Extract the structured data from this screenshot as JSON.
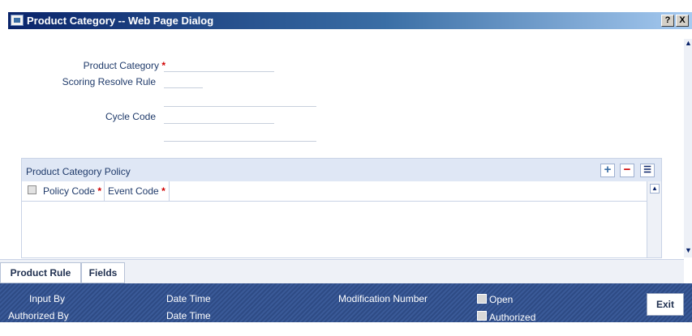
{
  "window": {
    "title": "Product Category -- Web Page Dialog",
    "help_label": "?",
    "close_label": "X"
  },
  "form": {
    "product_category_label": "Product Category",
    "scoring_resolve_rule_label": "Scoring Resolve Rule",
    "cycle_code_label": "Cycle Code",
    "required_mark": "*"
  },
  "policy_grid": {
    "title": "Product Category Policy",
    "add_label": "+",
    "remove_label": "−",
    "view_label": "☰",
    "columns": [
      "Policy Code",
      "Event Code"
    ],
    "required_mark": "*"
  },
  "tabs": [
    "Product Rule",
    "Fields"
  ],
  "footer": {
    "input_by": "Input By",
    "authorized_by": "Authorized By",
    "date_time_1": "Date Time",
    "date_time_2": "Date Time",
    "modification_number": "Modification Number",
    "open": "Open",
    "authorized": "Authorized",
    "exit": "Exit"
  },
  "colors": {
    "title_bar": "#0a246a",
    "footer": "#2e4b85",
    "grid_header": "#dfe7f5",
    "required": "#d00000"
  },
  "icons": [
    "dialog-icon",
    "help-icon",
    "close-icon",
    "add-row-icon",
    "remove-row-icon",
    "single-view-icon",
    "scroll-up-icon",
    "scroll-down-icon"
  ]
}
